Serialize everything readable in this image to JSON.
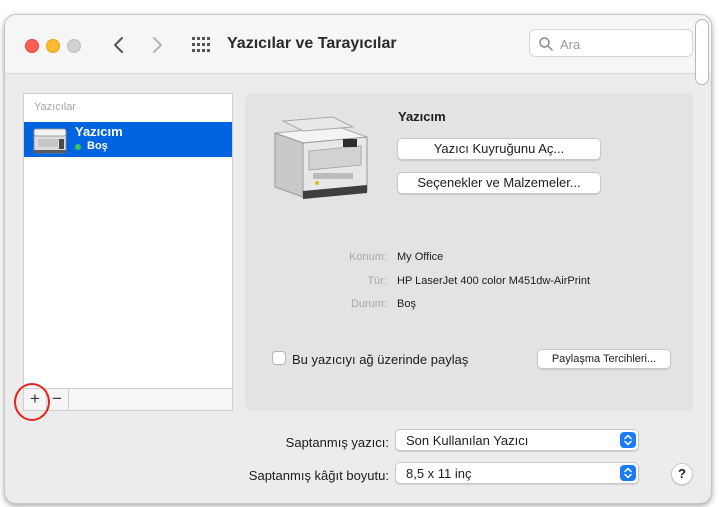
{
  "window": {
    "title": "Yazıcılar ve Tarayıcılar",
    "search_placeholder": "Ara"
  },
  "printer_list": {
    "header": "Yazıcılar",
    "items": [
      {
        "name": "Yazıcım",
        "status": "Boş",
        "status_color": "#34c759",
        "selected": true
      }
    ],
    "add_label": "+",
    "remove_label": "−"
  },
  "detail": {
    "printer_name": "Yazıcım",
    "queue_button": "Yazıcı Kuyruğunu Aç...",
    "options_button": "Seçenekler ve Malzemeler...",
    "info": [
      {
        "label": "Konum:",
        "value": "My Office"
      },
      {
        "label": "Tür:",
        "value": "HP LaserJet 400 color M451dw-AirPrint"
      },
      {
        "label": "Durum:",
        "value": "Boş"
      }
    ],
    "share_label": "Bu yazıcıyı ağ üzerinde paylaş",
    "share_checked": false,
    "share_prefs_button": "Paylaşma Tercihleri..."
  },
  "defaults": {
    "default_printer_label": "Saptanmış yazıcı:",
    "default_printer_value": "Son Kullanılan Yazıcı",
    "paper_size_label": "Saptanmış kâğıt boyutu:",
    "paper_size_value": "8,5 x 11 inç"
  },
  "help_label": "?",
  "colors": {
    "selection": "#0064e1",
    "highlight_ring": "#e3211d",
    "select_stepper": "#1a7cf5"
  },
  "icons": [
    "back-icon",
    "forward-icon",
    "grid-icon",
    "search-icon",
    "printer-icon",
    "chevron-updown-icon"
  ]
}
